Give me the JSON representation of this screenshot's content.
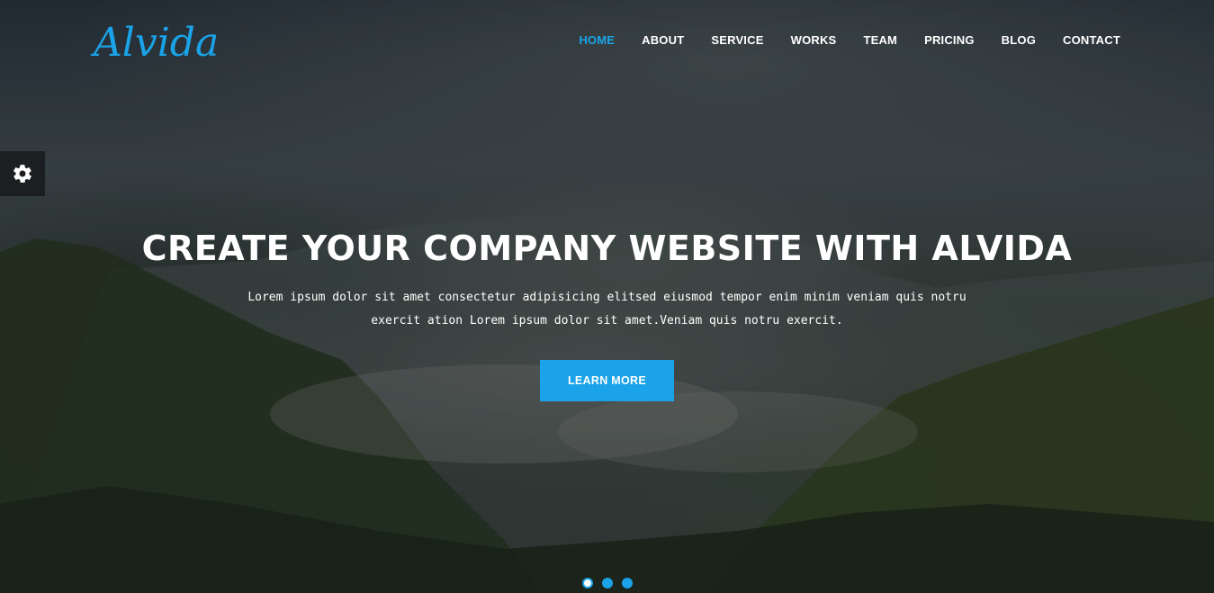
{
  "brand": {
    "logo_text": "Alvida"
  },
  "nav": {
    "items": [
      {
        "label": "HOME",
        "active": true
      },
      {
        "label": "ABOUT",
        "active": false
      },
      {
        "label": "SERVICE",
        "active": false
      },
      {
        "label": "WORKS",
        "active": false
      },
      {
        "label": "TEAM",
        "active": false
      },
      {
        "label": "PRICING",
        "active": false
      },
      {
        "label": "BLOG",
        "active": false
      },
      {
        "label": "CONTACT",
        "active": false
      }
    ]
  },
  "settings": {
    "icon": "gear-icon"
  },
  "hero": {
    "headline": "CREATE YOUR COMPANY WEBSITE WITH ALVIDA",
    "paragraph_line1": "Lorem ipsum dolor sit amet consectetur adipisicing elitsed eiusmod tempor enim minim veniam quis notru",
    "paragraph_line2": "exercit ation Lorem ipsum dolor sit amet.Veniam quis notru exercit.",
    "cta_label": "LEARN MORE"
  },
  "slider": {
    "slide_count": 3,
    "active_index": 0
  },
  "colors": {
    "accent": "#1aa3e8",
    "settings_bg": "#1b1f22",
    "text": "#ffffff"
  }
}
